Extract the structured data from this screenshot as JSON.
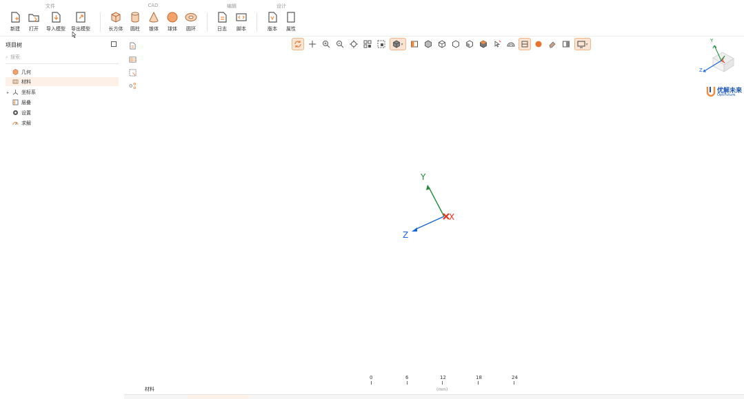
{
  "ribbon": {
    "groups": [
      {
        "title": "文件"
      },
      {
        "title": "CAD"
      },
      {
        "title": "编辑"
      },
      {
        "title": "设计"
      }
    ],
    "buttons": {
      "new": "新建",
      "open": "打开",
      "import_model": "导入模型",
      "export_model": "导出模型",
      "box": "长方体",
      "cylinder": "圆柱",
      "cone": "锥体",
      "sphere": "球体",
      "torus": "圆环",
      "log": "日志",
      "script": "脚本",
      "version": "版本",
      "properties": "属性"
    }
  },
  "project_tree": {
    "title": "项目树",
    "search_placeholder": "搜索",
    "items": [
      {
        "label": "几何"
      },
      {
        "label": "材料"
      },
      {
        "label": "坐标系"
      },
      {
        "label": "层叠"
      },
      {
        "label": "设置"
      },
      {
        "label": "求解"
      }
    ]
  },
  "axes": {
    "x": "X",
    "y": "Y",
    "z": "Z"
  },
  "logo": {
    "cn": "优解未来",
    "en": "OptiFuture"
  },
  "ruler": {
    "ticks": [
      "0",
      "6",
      "12",
      "18",
      "24"
    ],
    "unit": "(mm)"
  },
  "bottom": {
    "tab": "材料"
  },
  "colors": {
    "accent": "#f08a3c",
    "x_axis": "#e8321e",
    "y_axis": "#1c8a36",
    "z_axis": "#1565d8"
  }
}
